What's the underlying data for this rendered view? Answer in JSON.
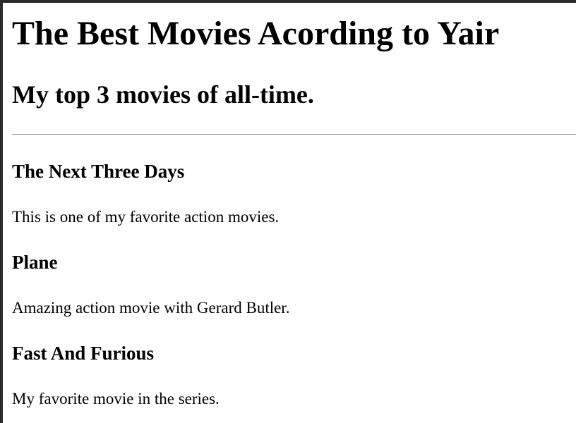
{
  "page": {
    "title": "The Best Movies Acording to Yair",
    "subtitle": "My top 3 movies of all-time."
  },
  "movies": [
    {
      "title": "The Next Three Days",
      "description": "This is one of my favorite action movies."
    },
    {
      "title": "Plane",
      "description": "Amazing action movie with Gerard Butler."
    },
    {
      "title": "Fast And Furious",
      "description": "My favorite movie in the series."
    }
  ],
  "colors": {
    "text": "#000000",
    "background": "#ffffff",
    "divider": "#9a9a9a"
  }
}
